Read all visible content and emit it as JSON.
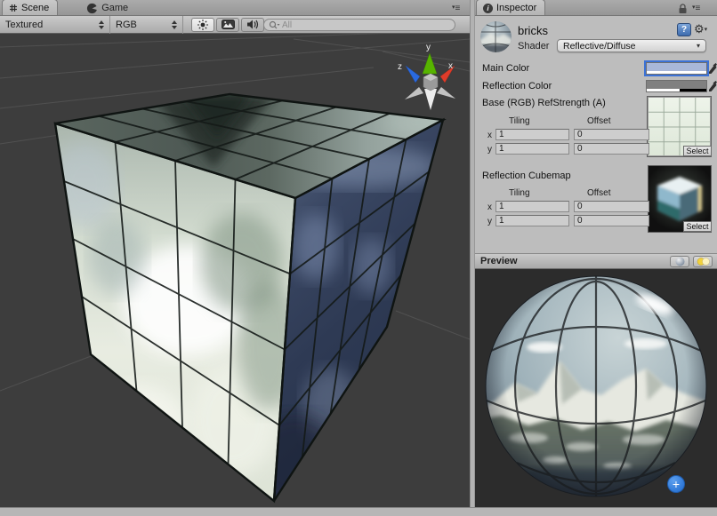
{
  "scene": {
    "tabs": {
      "scene": "Scene",
      "game": "Game"
    },
    "toolbar": {
      "draw_mode": "Textured",
      "color_mode": "RGB",
      "search_placeholder": "All"
    },
    "gizmo": {
      "x": "x",
      "y": "y",
      "z": "z"
    }
  },
  "inspector": {
    "tab_label": "Inspector",
    "material_name": "bricks",
    "shader_label": "Shader",
    "shader_value": "Reflective/Diffuse",
    "main_color_label": "Main Color",
    "reflection_color_label": "Reflection Color",
    "base_map_label": "Base (RGB) RefStrength (A)",
    "cubemap_label": "Reflection Cubemap",
    "tiling_header": "Tiling",
    "offset_header": "Offset",
    "row_x": "x",
    "row_y": "y",
    "select_label": "Select",
    "base": {
      "tiling_x": "1",
      "tiling_y": "1",
      "offset_x": "0",
      "offset_y": "0"
    },
    "cubemap": {
      "tiling_x": "1",
      "tiling_y": "1",
      "offset_x": "0",
      "offset_y": "0"
    },
    "colors": {
      "main": "#a9b7d8",
      "reflection": "#808080"
    }
  },
  "preview": {
    "title": "Preview"
  },
  "icons": {
    "info": "i",
    "help": "?",
    "gear": "⚙",
    "menu_tri": "▾",
    "menu_lines": "≡",
    "plus": "+"
  }
}
